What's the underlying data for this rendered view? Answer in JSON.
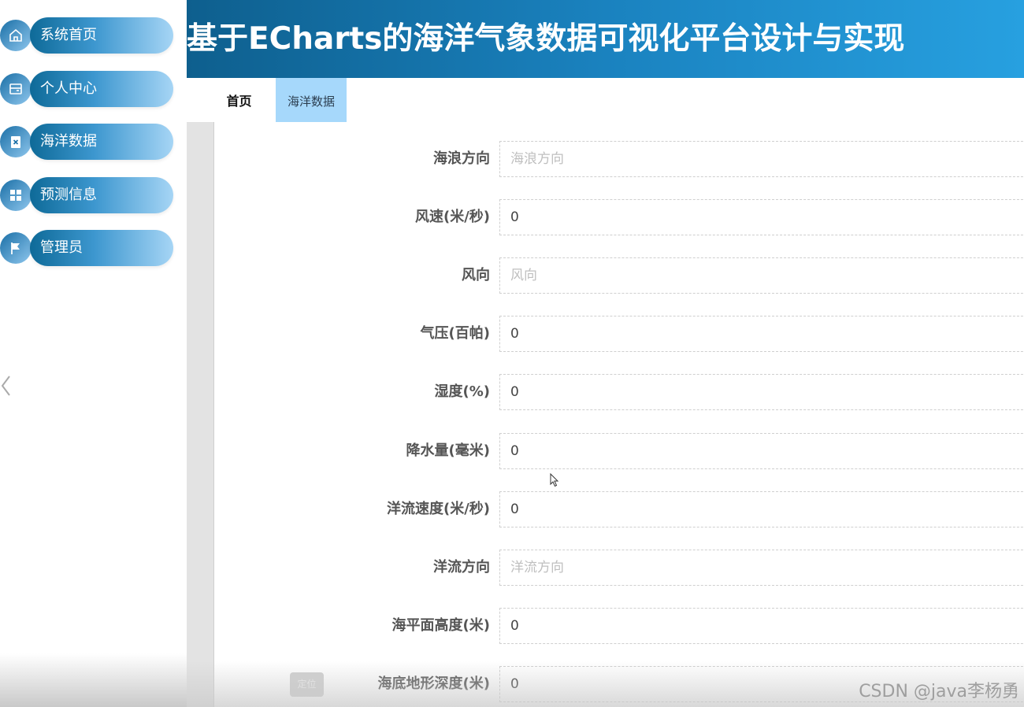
{
  "sidebar": {
    "items": [
      {
        "label": "系统首页",
        "icon": "home-icon"
      },
      {
        "label": "个人中心",
        "icon": "wallet-icon"
      },
      {
        "label": "海洋数据",
        "icon": "clipboard-icon"
      },
      {
        "label": "预测信息",
        "icon": "grid-icon"
      },
      {
        "label": "管理员",
        "icon": "flag-icon"
      }
    ],
    "collapse_icon": "chevron-left-icon"
  },
  "header": {
    "title": "基于ECharts的海洋气象数据可视化平台设计与实现"
  },
  "tabs": [
    {
      "label": "首页",
      "active": false
    },
    {
      "label": "海洋数据",
      "active": true
    }
  ],
  "form": {
    "fields": [
      {
        "label": "海浪方向",
        "value": "",
        "placeholder": "海浪方向"
      },
      {
        "label": "风速(米/秒)",
        "value": "0",
        "placeholder": ""
      },
      {
        "label": "风向",
        "value": "",
        "placeholder": "风向"
      },
      {
        "label": "气压(百帕)",
        "value": "0",
        "placeholder": ""
      },
      {
        "label": "湿度(%)",
        "value": "0",
        "placeholder": ""
      },
      {
        "label": "降水量(毫米)",
        "value": "0",
        "placeholder": ""
      },
      {
        "label": "洋流速度(米/秒)",
        "value": "0",
        "placeholder": ""
      },
      {
        "label": "洋流方向",
        "value": "",
        "placeholder": "洋流方向"
      },
      {
        "label": "海平面高度(米)",
        "value": "0",
        "placeholder": ""
      },
      {
        "label": "海底地形深度(米)",
        "value": "0",
        "placeholder": ""
      }
    ],
    "locate_button": "定位"
  },
  "watermark": "CSDN @java李杨勇",
  "colors": {
    "header_start": "#0e5f8e",
    "header_end": "#27a0e0",
    "active_tab": "#a6d8fb",
    "nav_pill": "#3d97cf"
  }
}
